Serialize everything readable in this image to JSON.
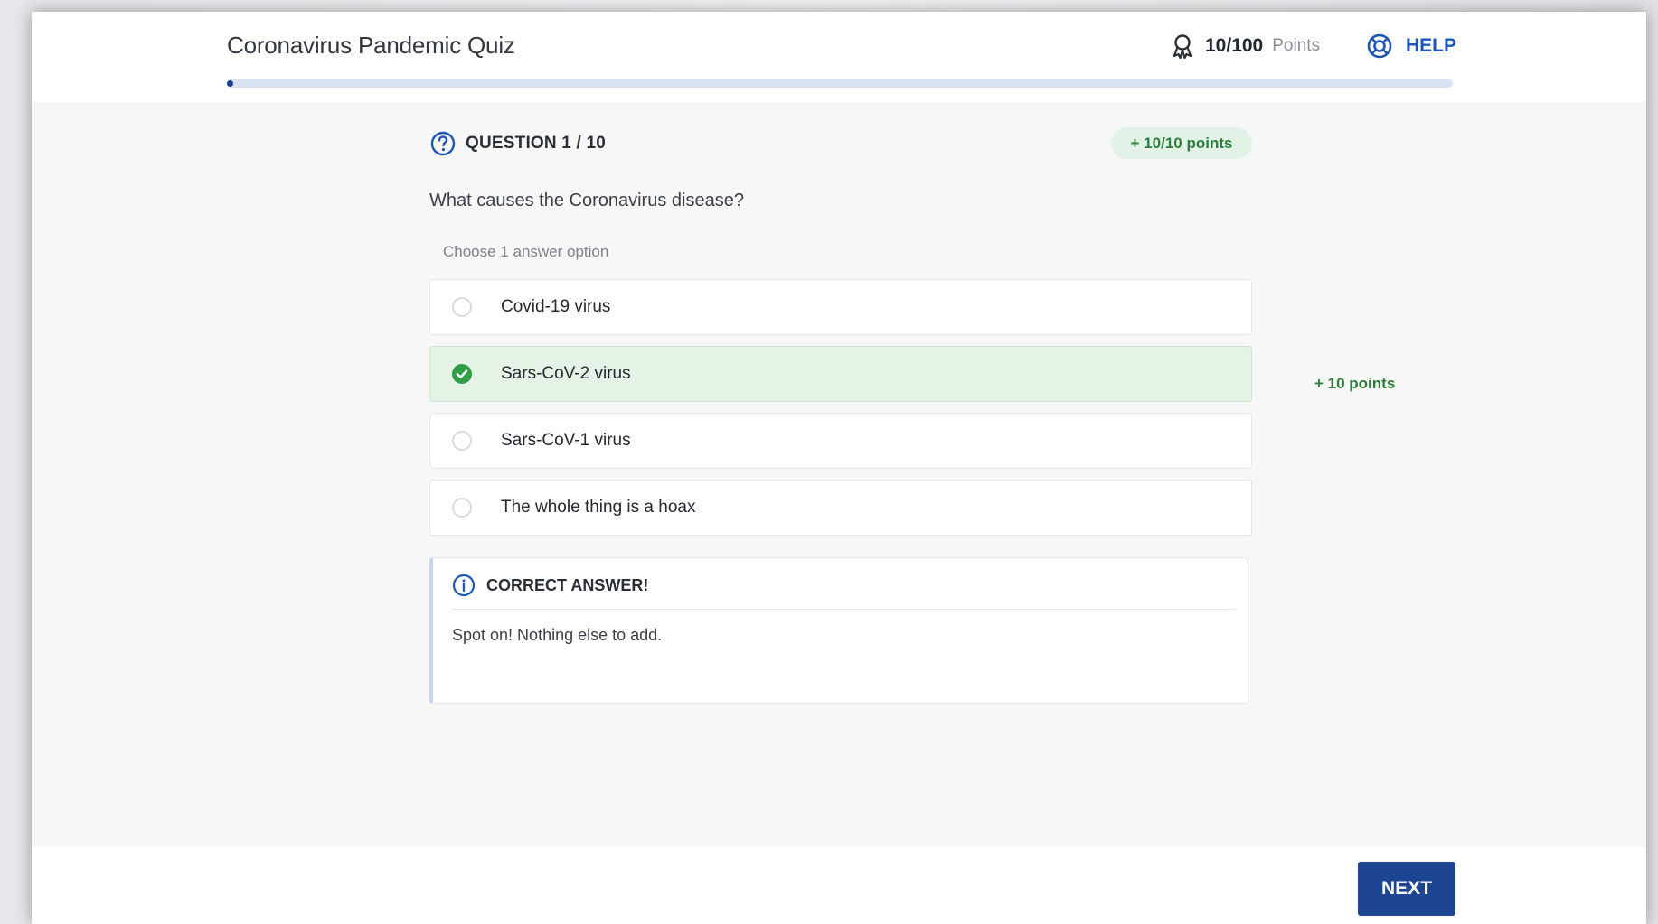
{
  "header": {
    "title": "Coronavirus Pandemic Quiz",
    "score_value": "10/100",
    "score_unit": "Points",
    "help_label": "HELP",
    "progress": 0.005
  },
  "question": {
    "counter": "QUESTION 1 / 10",
    "points_badge": "+ 10/10 points",
    "text": "What causes the Coronavirus disease?",
    "instruction": "Choose 1 answer option",
    "options": [
      {
        "label": "Covid-19 virus",
        "selected": false
      },
      {
        "label": "Sars-CoV-2 virus",
        "selected": true
      },
      {
        "label": "Sars-CoV-1 virus",
        "selected": false
      },
      {
        "label": "The whole thing is a hoax",
        "selected": false
      }
    ],
    "selected_points": "+ 10 points"
  },
  "feedback": {
    "title": "CORRECT ANSWER!",
    "text": "Spot on! Nothing else to add."
  },
  "footer": {
    "next_label": "NEXT"
  },
  "colors": {
    "accent": "#1e4591",
    "success": "#2f7d3d",
    "success_bg": "#e5f3e7"
  },
  "icons": [
    "award-icon",
    "help-lifebuoy-icon",
    "question-circle-icon",
    "check-circle-icon",
    "info-icon"
  ]
}
